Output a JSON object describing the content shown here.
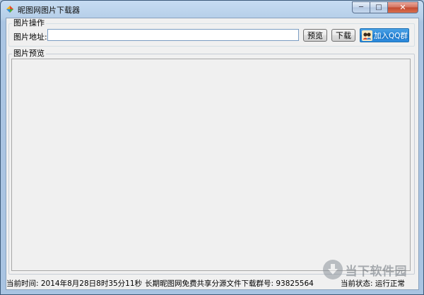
{
  "window": {
    "title": "昵图网图片下载器",
    "controls": {
      "minimize": "─",
      "maximize": "□",
      "close": "✕"
    }
  },
  "image_ops": {
    "group_title": "图片操作",
    "url_label": "图片地址:",
    "url_value": "",
    "preview_button": "预览",
    "download_button": "下载",
    "qq_button": "加入QQ群"
  },
  "preview": {
    "group_title": "图片预览"
  },
  "status": {
    "time": "当前时间: 2014年8月28日8时35分11秒",
    "group_info": "长期昵图网免费共享分源文件下载群号: 93825564",
    "state": "当前状态: 运行正常"
  },
  "watermark": {
    "text": "当下软件园"
  },
  "colors": {
    "accent": "#2a86d6",
    "window_frame": "#aec6e0",
    "client_bg": "#f0f0f0"
  }
}
